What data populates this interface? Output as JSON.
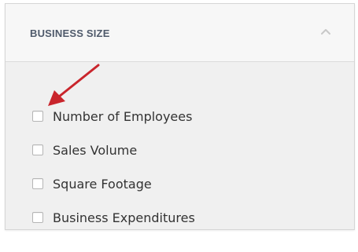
{
  "filter_panel": {
    "title": "BUSINESS SIZE",
    "header_icon": "chevron-up-icon",
    "annotation_icon": "red-arrow-icon",
    "accent_color": "#c9252c",
    "options": [
      {
        "label": "Number of Employees",
        "checked": false
      },
      {
        "label": "Sales Volume",
        "checked": false
      },
      {
        "label": "Square Footage",
        "checked": false
      },
      {
        "label": "Business Expenditures",
        "checked": false
      }
    ]
  }
}
